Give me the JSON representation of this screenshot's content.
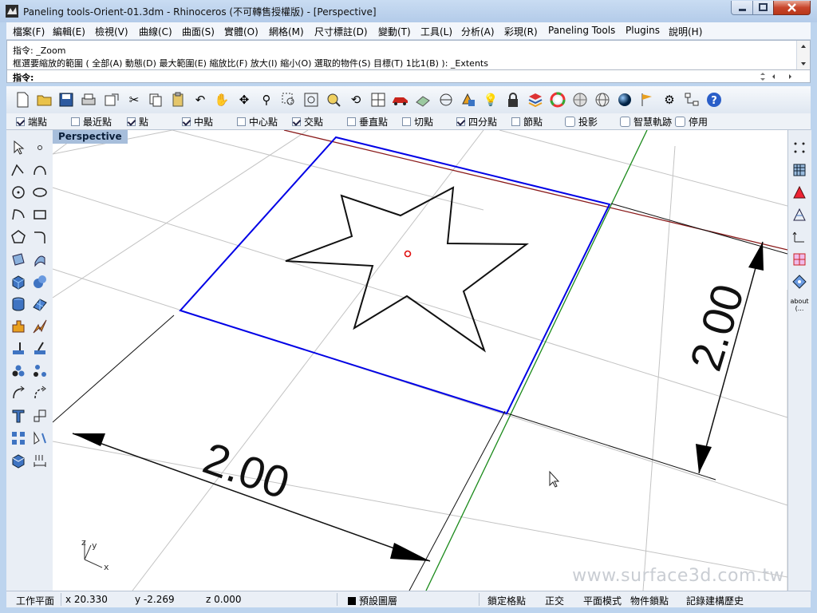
{
  "window": {
    "title": "Paneling tools-Orient-01.3dm - Rhinoceros (不可轉售授權版) - [Perspective]"
  },
  "menu": {
    "items": [
      "檔案(F)",
      "編輯(E)",
      "檢視(V)",
      "曲線(C)",
      "曲面(S)",
      "實體(O)",
      "網格(M)",
      "尺寸標註(D)",
      "變動(T)",
      "工具(L)",
      "分析(A)",
      "彩現(R)",
      "Paneling Tools",
      "Plugins",
      "說明(H)"
    ]
  },
  "command": {
    "line1": "指令: _Zoom",
    "line2": "框選要縮放的範圍 ( 全部(A)  動態(D)  最大範圍(E)  縮放比(F)  放大(I)  縮小(O)  選取的物件(S)  目標(T)  1比1(B) ): _Extents",
    "prompt": "指令:"
  },
  "osnap": {
    "items": [
      {
        "label": "端點",
        "checked": true
      },
      {
        "label": "最近點",
        "checked": false
      },
      {
        "label": "點",
        "checked": true
      },
      {
        "label": "中點",
        "checked": true
      },
      {
        "label": "中心點",
        "checked": false
      },
      {
        "label": "交點",
        "checked": true
      },
      {
        "label": "垂直點",
        "checked": false
      },
      {
        "label": "切點",
        "checked": false
      },
      {
        "label": "四分點",
        "checked": true
      },
      {
        "label": "節點",
        "checked": false
      }
    ],
    "toggles": [
      {
        "label": "投影",
        "checked": false
      },
      {
        "label": "智慧軌跡",
        "checked": false
      },
      {
        "label": "停用",
        "checked": false
      }
    ]
  },
  "viewport": {
    "label": "Perspective",
    "dim_bottom": "2.00",
    "dim_right": "2.00",
    "axis_z": "z",
    "axis_y": "y",
    "axis_x": "x",
    "watermark": "www.surface3d.com.tw",
    "colors": {
      "square": "#0000e6",
      "star": "#111111",
      "grid": "#c0c0c0",
      "x_axis": "#8a1a1a",
      "y_axis": "#1a8a1a",
      "point": "#e01010"
    }
  },
  "side": {
    "about_label": "about",
    "about_sub": "(..."
  },
  "status": {
    "cplane": "工作平面",
    "x": "x 20.330",
    "y": "y -2.269",
    "z": "z 0.000",
    "layer": "預設圖層",
    "grid_snap": "鎖定格點",
    "ortho": "正交",
    "planar": "平面模式",
    "osnap": "物件鎖點",
    "history": "記錄建構歷史"
  }
}
